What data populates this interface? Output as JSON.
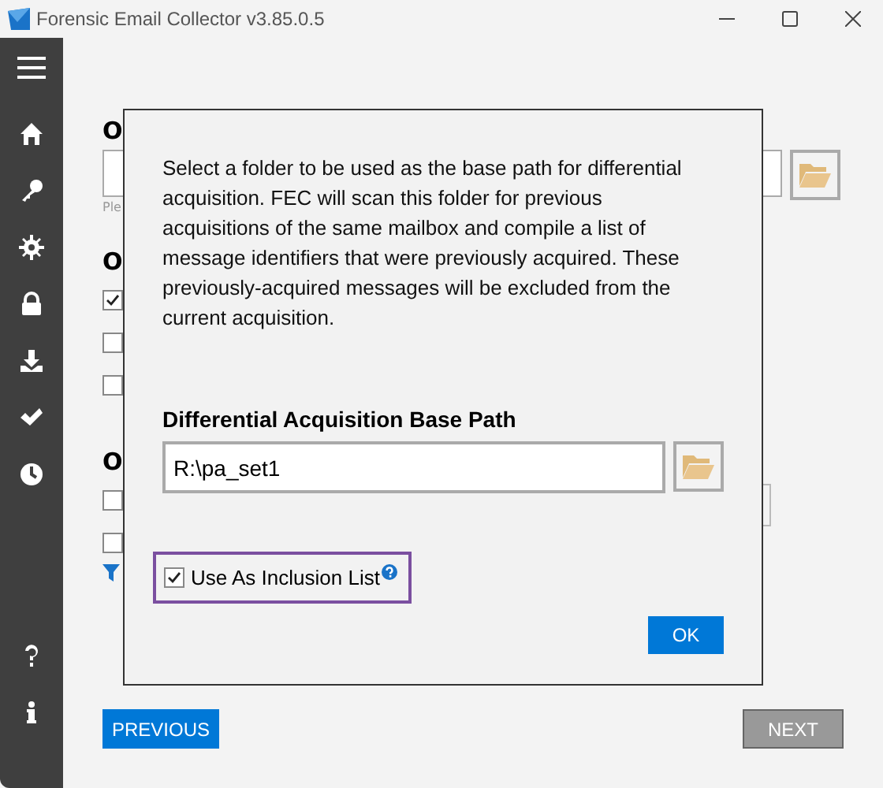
{
  "window": {
    "title": "Forensic Email Collector v3.85.0.5"
  },
  "background": {
    "sections": [
      {
        "heading": "O",
        "field": {
          "hint": "Ple"
        }
      },
      {
        "heading": "O",
        "options": [
          {
            "checked": true
          },
          {
            "checked": false
          },
          {
            "checked": false
          }
        ]
      },
      {
        "heading": "O",
        "options": [
          {
            "checked": false
          },
          {
            "checked": false
          }
        ]
      }
    ],
    "buttons": [
      {
        "label": "PREVIOUS",
        "disabled": false
      },
      {
        "label": "NEXT",
        "disabled": true
      }
    ]
  },
  "dialog": {
    "message": "Select a folder to be used as the base path for differential acquisition. FEC will scan this folder for previous acquisitions of the same mailbox and compile a list of message identifiers that were previously acquired. These previously-acquired messages will be excluded from the current acquisition.",
    "path_label": "Differential Acquisition Base Path",
    "path_value": "R:\\pa_set1",
    "inclusion": {
      "label": "Use As Inclusion List",
      "checked": true
    },
    "ok": "OK"
  }
}
